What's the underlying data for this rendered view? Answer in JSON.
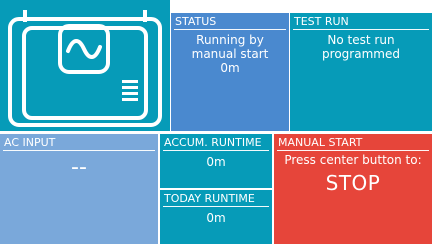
{
  "device": {
    "icon": "generator-icon"
  },
  "status": {
    "title": "STATUS",
    "lines": [
      "Running by",
      "manual start",
      "0m"
    ]
  },
  "test_run": {
    "title": "TEST RUN",
    "lines": [
      "No test run",
      "programmed"
    ]
  },
  "ac_input": {
    "title": "AC INPUT",
    "value": "--"
  },
  "accum_runtime": {
    "title": "ACCUM. RUNTIME",
    "value": "0m"
  },
  "today_runtime": {
    "title": "TODAY RUNTIME",
    "value": "0m"
  },
  "manual_start": {
    "title": "MANUAL START",
    "prompt": "Press center button to:",
    "action": "STOP"
  },
  "colors": {
    "cyan": "#069bb8",
    "blue": "#4a89cf",
    "light_blue": "#7aa8da",
    "red": "#e6453a"
  }
}
